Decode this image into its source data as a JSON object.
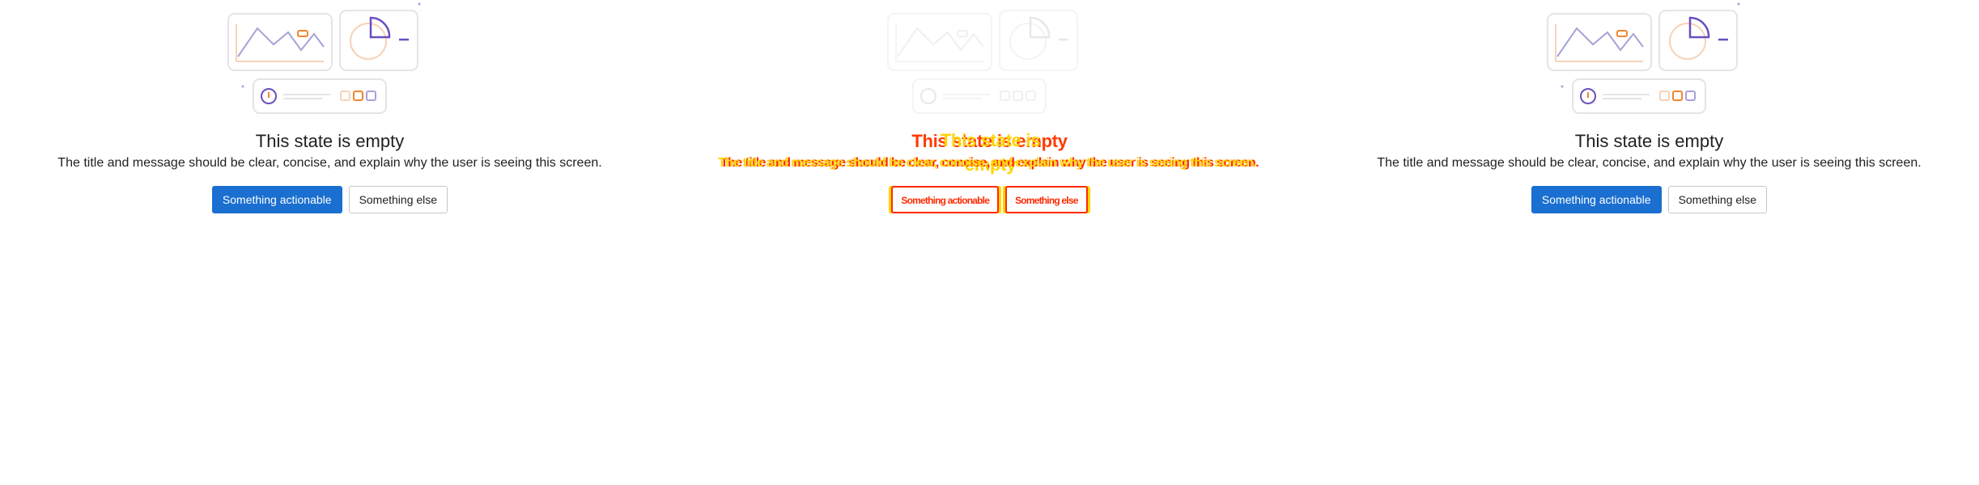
{
  "panels": [
    {
      "id": "left",
      "title": "This state is empty",
      "message": "The title and message should be clear, concise, and explain why the user is seeing this screen.",
      "primary_action": "Something actionable",
      "secondary_action": "Something else"
    },
    {
      "id": "middle",
      "title": "This state is empty",
      "message": "The title and message should be clear, concise, and explain why the user is seeing this screen.",
      "primary_action": "Something actionable",
      "secondary_action": "Something else"
    },
    {
      "id": "right",
      "title": "This state is empty",
      "message": "The title and message should be clear, concise, and explain why the user is seeing this screen.",
      "primary_action": "Something actionable",
      "secondary_action": "Something else"
    }
  ],
  "colors": {
    "primary_button": "#1a6fd0",
    "illustration_outline": "#e6e3e8",
    "illustration_purple": "#6a4fbf",
    "illustration_orange": "#f0852d",
    "illustration_line_chart": "#a7a2d6",
    "middle_text_red": "#ff2a00",
    "middle_text_yellow": "#ffd400"
  },
  "icons": [
    "line-chart-icon",
    "pie-chart-icon",
    "info-icon",
    "status-squares-icon"
  ]
}
